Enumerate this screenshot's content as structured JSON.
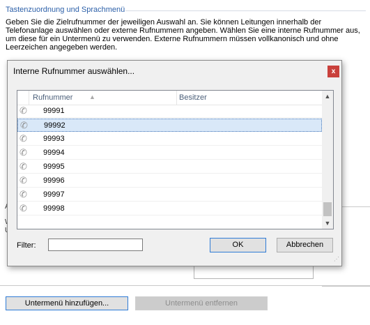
{
  "section": {
    "title": "Tastenzuordnung und Sprachmenü",
    "description": "Geben Sie die Zielrufnummer der jeweiligen Auswahl an. Sie können Leitungen innerhalb der Telefonanlage auswählen oder externe Rufnummern angeben. Wählen Sie eine interne Rufnummer aus, um diese für ein Untermenü zu verwenden. Externe Rufnummern müssen vollkanonisch und ohne Leerzeichen angegeben werden."
  },
  "background": {
    "partial_letters": [
      "A",
      "W",
      "U"
    ]
  },
  "bottom_buttons": {
    "add_submenu": "Untermenü hinzufügen...",
    "remove_submenu": "Untermenü entfernen"
  },
  "dialog": {
    "title": "Interne Rufnummer auswählen...",
    "close_glyph": "x",
    "columns": {
      "number": "Rufnummer",
      "owner": "Besitzer"
    },
    "sort_icon": "▲",
    "rows": [
      {
        "icon": "phone-icon",
        "number": "99991",
        "owner": ""
      },
      {
        "icon": "phone-icon",
        "number": "99992",
        "owner": "",
        "selected": true
      },
      {
        "icon": "phone-icon",
        "number": "99993",
        "owner": ""
      },
      {
        "icon": "phone-icon",
        "number": "99994",
        "owner": ""
      },
      {
        "icon": "phone-icon",
        "number": "99995",
        "owner": ""
      },
      {
        "icon": "phone-icon",
        "number": "99996",
        "owner": ""
      },
      {
        "icon": "phone-icon",
        "number": "99997",
        "owner": ""
      },
      {
        "icon": "phone-icon",
        "number": "99998",
        "owner": ""
      }
    ],
    "scrollbar": {
      "up": "▲",
      "down": "▼",
      "position_fraction": 0.92
    },
    "filter": {
      "label": "Filter:",
      "value": "",
      "placeholder": ""
    },
    "ok_label": "OK",
    "cancel_label": "Abbrechen"
  },
  "colors": {
    "section_title": "#2b5fa8",
    "close_button": "#c9403b",
    "selected_row": "#d9e8f8",
    "default_button_border": "#2e7bd6"
  }
}
